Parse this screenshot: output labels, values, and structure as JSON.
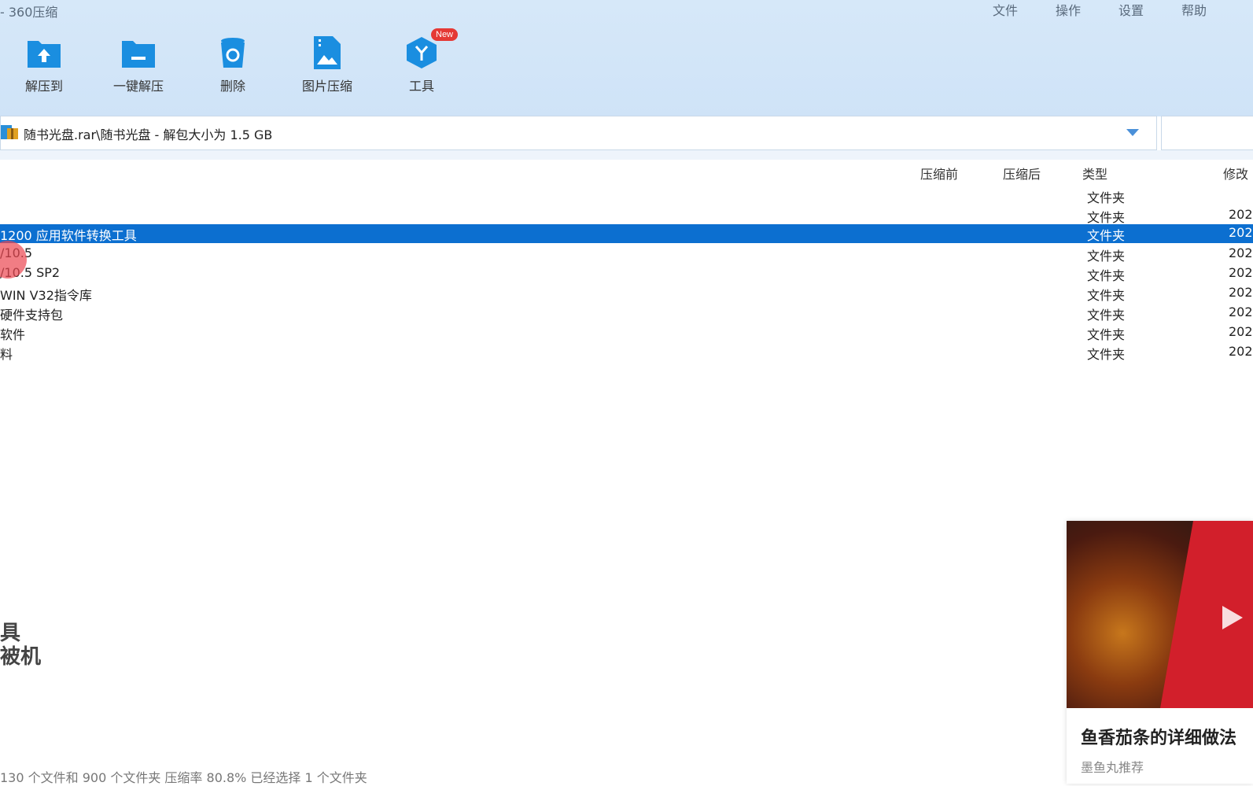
{
  "app": {
    "title": "- 360压缩"
  },
  "menu": {
    "file": "文件",
    "operate": "操作",
    "settings": "设置",
    "help": "帮助"
  },
  "toolbar": {
    "extract_to": "解压到",
    "one_click": "一键解压",
    "delete": "删除",
    "image_compress": "图片压缩",
    "tools": "工具",
    "tools_badge": "New"
  },
  "address": {
    "path": "随书光盘.rar\\随书光盘 - 解包大小为 1.5 GB"
  },
  "columns": {
    "before": "压缩前",
    "after": "压缩后",
    "type": "类型",
    "modified": "修改"
  },
  "rows": [
    {
      "name": "",
      "type": "文件夹",
      "mod": ""
    },
    {
      "name": "",
      "type": "文件夹",
      "mod": "202"
    },
    {
      "name": "1200 应用软件转换工具",
      "type": "文件夹",
      "mod": "202"
    },
    {
      "name": "/10.5",
      "type": "文件夹",
      "mod": "202"
    },
    {
      "name": "/10.5 SP2",
      "type": "文件夹",
      "mod": "202"
    },
    {
      "name": " WIN V32指令库",
      "type": "文件夹",
      "mod": "202"
    },
    {
      "name": "硬件支持包",
      "type": "文件夹",
      "mod": "202"
    },
    {
      "name": "软件",
      "type": "文件夹",
      "mod": "202"
    },
    {
      "name": "料",
      "type": "文件夹",
      "mod": "202"
    }
  ],
  "watermark": {
    "line1": "具",
    "line2": "被机"
  },
  "status": {
    "text": "130 个文件和 900 个文件夹 压缩率 80.8% 已经选择 1 个文件夹"
  },
  "ad": {
    "title": "鱼香茄条的详细做法",
    "source": "墨鱼丸推荐"
  },
  "colors": {
    "selection": "#0c6fd0",
    "toolbar_bg": "#d6e8f9",
    "icon_blue": "#1a8ee0",
    "badge": "#e53935"
  }
}
